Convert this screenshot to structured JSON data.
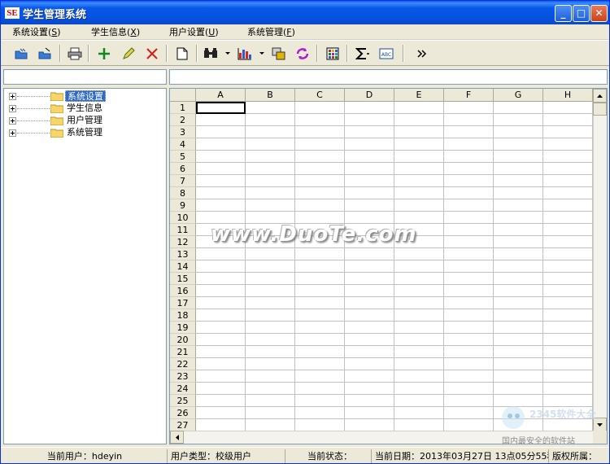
{
  "window": {
    "title": "学生管理系统",
    "icon_text": "SE"
  },
  "menu": [
    {
      "label": "系统设置",
      "accel": "S"
    },
    {
      "label": "学生信息",
      "accel": "X"
    },
    {
      "label": "用户设置",
      "accel": "U"
    },
    {
      "label": "系统管理",
      "accel": "F"
    }
  ],
  "toolbar": {
    "icons": [
      "open-icon",
      "save-icon",
      "print-icon",
      "add-icon",
      "edit-icon",
      "delete-icon",
      "new-document-icon",
      "find-icon",
      "chart-icon",
      "copy-icon",
      "refresh-icon",
      "grid-palette-icon",
      "sum-icon",
      "text-format-icon",
      "more-chevron-icon"
    ],
    "format_label": "ABC"
  },
  "tree": {
    "items": [
      {
        "label": "系统设置",
        "selected": true
      },
      {
        "label": "学生信息",
        "selected": false
      },
      {
        "label": "用户管理",
        "selected": false
      },
      {
        "label": "系统管理",
        "selected": false
      }
    ]
  },
  "grid": {
    "columns": [
      "A",
      "B",
      "C",
      "D",
      "E",
      "F",
      "G",
      "H"
    ],
    "rows": [
      "1",
      "2",
      "3",
      "4",
      "5",
      "6",
      "7",
      "8",
      "9",
      "10",
      "11",
      "12",
      "13",
      "14",
      "15",
      "16",
      "17",
      "18",
      "19",
      "20",
      "21",
      "22",
      "23",
      "24",
      "25",
      "26",
      "27"
    ]
  },
  "status": {
    "current_user": "当前用户：hdeyin",
    "user_type": "用户类型：校级用户",
    "current_state": "当前状态：",
    "current_date": "当前日期：2013年03月27日 13点05分55秒",
    "copyright": "版权所属："
  },
  "watermark": {
    "text": "www.DuoTe.com",
    "logo_text": "国内最安全的软件站",
    "logo_brand": "2345软件大全"
  }
}
